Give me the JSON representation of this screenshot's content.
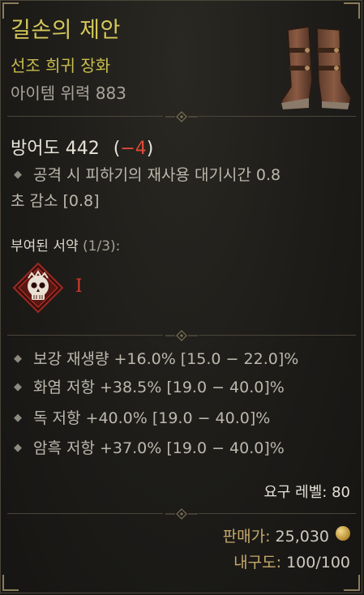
{
  "item": {
    "name": "길손의 제안",
    "type_line": "선조 희귀 장화",
    "power_label": "아이템 위력 883"
  },
  "armor": {
    "label": "방어도 442",
    "open_paren": "(",
    "diff": "−4",
    "close_paren": ")"
  },
  "implicit": {
    "line1": "공격 시 피하기의 재사용 대기시간 0.8",
    "line2": "초 감소 [0.8]"
  },
  "pact": {
    "heading": "부여된 서약",
    "count": "(1/3):",
    "rank": "I",
    "icon": "skull-sigil-icon"
  },
  "affixes": [
    "보강 재생량 +16.0% [15.0 − 22.0]%",
    "화염 저항 +38.5% [19.0 − 40.0]%",
    "독 저항 +40.0% [19.0 − 40.0]%",
    "암흑 저항 +37.0% [19.0 − 40.0]%"
  ],
  "requirement": "요구 레벨: 80",
  "sell": {
    "label": "판매가:",
    "value": "25,030",
    "icon": "gold-coin-icon"
  },
  "durability": {
    "label": "내구도:",
    "value": "100/100"
  },
  "colors": {
    "unique_name": "#d6c95a",
    "penalty": "#e04a3a",
    "pact_red": "#d23a2c"
  }
}
